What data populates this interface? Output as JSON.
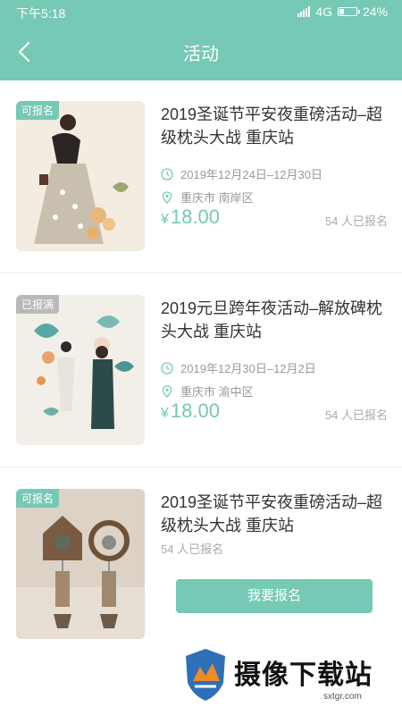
{
  "status_bar": {
    "time": "下午5:18",
    "network": "4G",
    "battery": "24%"
  },
  "nav": {
    "title": "活动"
  },
  "activities": [
    {
      "badge": "可报名",
      "title": "2019圣诞节平安夜重磅活动–超级枕头大战 重庆站",
      "date": "2019年12月24日–12月30日",
      "location": "重庆市 南岸区",
      "price_symbol": "¥",
      "price": "18.00",
      "count": "54 人已报名"
    },
    {
      "badge": "已报满",
      "title": "2019元旦跨年夜活动–解放碑枕头大战 重庆站",
      "date": "2019年12月30日–12月2日",
      "location": "重庆市 渝中区",
      "price_symbol": "¥",
      "price": "18.00",
      "count": "54 人已报名"
    },
    {
      "badge": "可报名",
      "title": "2019圣诞节平安夜重磅活动–超级枕头大战 重庆站",
      "count": "54 人已报名",
      "button": "我要报名"
    }
  ],
  "watermark": {
    "text": "摄像下载站",
    "url": "sxtgr.com"
  },
  "colors": {
    "accent": "#76c9b4",
    "badge_full": "#b9b9b9"
  }
}
